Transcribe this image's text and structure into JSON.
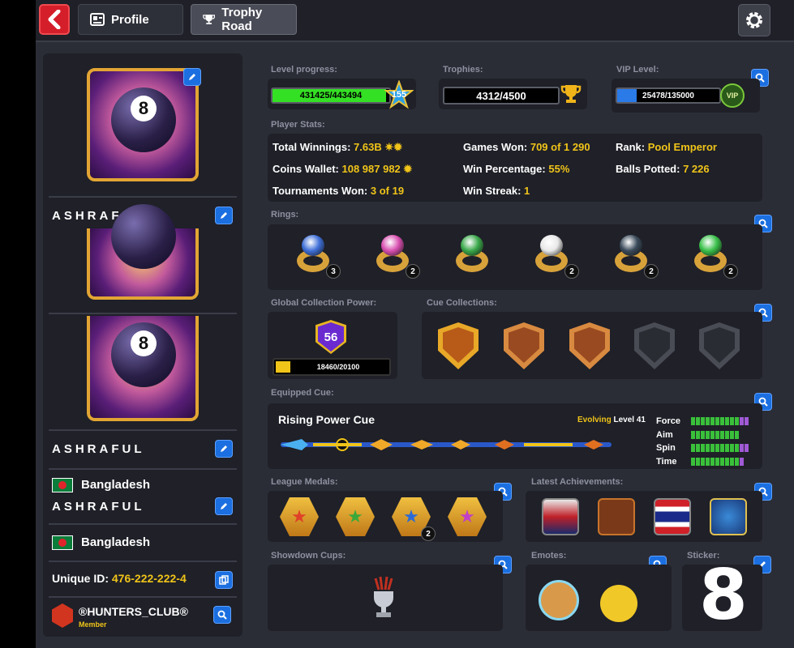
{
  "header": {
    "profile_tab": "Profile",
    "trophy_tab": "Trophy Road"
  },
  "profile": {
    "name": "ASHRAFUL",
    "country": "Bangladesh",
    "unique_id_label": "Unique ID:",
    "unique_id": "476-222-222-4",
    "club_name": "®HUNTERS_CLUB®",
    "club_role": "Member",
    "avatar_number": "8"
  },
  "level": {
    "label": "Level progress:",
    "value_text": "431425/443494",
    "level": "155",
    "fraction": 0.973
  },
  "trophies": {
    "label": "Trophies:",
    "value_text": "4312/4500"
  },
  "vip": {
    "label": "VIP Level:",
    "value_text": "25478/135000",
    "badge": "VIP",
    "fraction": 0.189
  },
  "stats": {
    "label": "Player Stats:",
    "total_winnings_label": "Total Winnings:",
    "total_winnings": "7.63B",
    "coins_wallet_label": "Coins Wallet:",
    "coins_wallet": "108 987 982",
    "tournaments_won_label": "Tournaments Won:",
    "tournaments_won": "3 of 19",
    "games_won_label": "Games Won:",
    "games_won": "709 of 1 290",
    "win_percentage_label": "Win Percentage:",
    "win_percentage": "55%",
    "win_streak_label": "Win Streak:",
    "win_streak": "1",
    "rank_label": "Rank:",
    "rank": "Pool Emperor",
    "balls_potted_label": "Balls Potted:",
    "balls_potted": "7 226"
  },
  "rings": {
    "label": "Rings:",
    "items": [
      {
        "count": "3",
        "gem": "#3f6fd8"
      },
      {
        "count": "2",
        "gem": "#d84fb0"
      },
      {
        "count": "",
        "gem": "#3aa84a"
      },
      {
        "count": "2",
        "gem": "#e8e8e8"
      },
      {
        "count": "2",
        "gem": "#3a4a5a"
      },
      {
        "count": "2",
        "gem": "#3ac04a"
      }
    ]
  },
  "collection": {
    "label": "Global Collection Power:",
    "power": "56",
    "value_text": "18460/20100",
    "fraction": 0.918
  },
  "cue_collections": {
    "label": "Cue Collections:"
  },
  "equipped_cue": {
    "label": "Equipped Cue:",
    "name": "Rising Power Cue",
    "evolving": "Evolving",
    "level": "Level 41",
    "stats": [
      {
        "name": "Force",
        "value": 10,
        "max": 12
      },
      {
        "name": "Aim",
        "value": 10,
        "max": 10
      },
      {
        "name": "Spin",
        "value": 10,
        "max": 12
      },
      {
        "name": "Time",
        "value": 10,
        "max": 11
      }
    ]
  },
  "league": {
    "label": "League Medals:",
    "medals": [
      {
        "color": "#e04028",
        "count": ""
      },
      {
        "color": "#3aa83a",
        "count": ""
      },
      {
        "color": "#2a6ad8",
        "count": "2"
      },
      {
        "color": "#c040c8",
        "count": ""
      }
    ]
  },
  "achievements": {
    "label": "Latest Achievements:"
  },
  "showdown": {
    "label": "Showdown Cups:"
  },
  "emotes": {
    "label": "Emotes:"
  },
  "sticker": {
    "label": "Sticker:",
    "glyph": "8"
  },
  "colors": {
    "accent_yellow": "#f0c419",
    "button_blue": "#1b6fe0",
    "back_red": "#d41f2a",
    "level_green": "#34e024",
    "vip_blue": "#2a7ae8"
  }
}
